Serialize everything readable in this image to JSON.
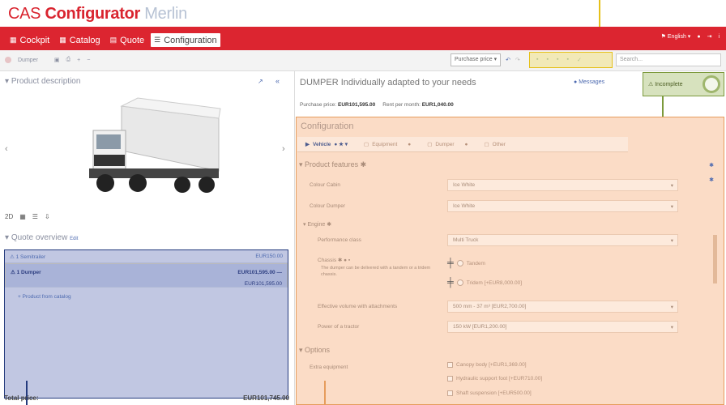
{
  "brand": {
    "cas": "CAS",
    "configurator": "Configurator",
    "merlin": "Merlin"
  },
  "nav": {
    "items": [
      {
        "label": "Cockpit"
      },
      {
        "label": "Catalog"
      },
      {
        "label": "Quote"
      },
      {
        "label": "Configuration"
      }
    ],
    "language": "English",
    "info": "i"
  },
  "toolbar": {
    "product": "Dumper",
    "price_select": "Purchase price",
    "search_placeholder": "Search..."
  },
  "left": {
    "product_description": "Product description",
    "quote_overview": "Quote overview",
    "edit": "Edit",
    "quote_rows": [
      {
        "name": "1 Semitrailer",
        "price": "EUR150.00",
        "price2": ""
      },
      {
        "name": "1 Dumper",
        "price": "EUR101,595.00",
        "price2": "EUR101,595.00"
      }
    ],
    "product_from_catalog": "+ Product from catalog",
    "total_label": "Total price:",
    "total_value": "EUR101,745.00",
    "view_2d": "2D"
  },
  "right": {
    "title": "DUMPER Individually adapted to your needs",
    "messages": "Messages",
    "incomplete": "Incomplete",
    "purchase_price_label": "Purchase price:",
    "purchase_price_value": "EUR101,595.00",
    "rent_label": "Rent per month:",
    "rent_value": "EUR1,040.00",
    "config": {
      "title": "Configuration",
      "tabs": [
        "Vehicle",
        "Equipment",
        "Dumper",
        "Other"
      ],
      "product_features": "Product features",
      "colour_cabin_label": "Colour Cabin",
      "colour_cabin_value": "Ice White",
      "colour_dumper_label": "Colour Dumper",
      "colour_dumper_value": "Ice White",
      "engine": "Engine",
      "performance_label": "Performance class",
      "performance_value": "Multi Truck",
      "chassis_label": "Chassis",
      "chassis_desc": "The dumper can be delivered with a tandem or a tridem chassis.",
      "tandem": "Tandem",
      "tridem": "Tridem [+EUR8,000.00]",
      "volume_label": "Effective volume with attachments",
      "volume_value": "500 mm - 37 m³ [EUR2,700.00]",
      "power_label": "Power of a tractor",
      "power_value": "150 kW [EUR1,200.00]",
      "options": "Options",
      "extra_label": "Extra equipment",
      "extras": [
        "Canopy body [+EUR1,369.00]",
        "Hydraulic support foot [+EUR710.00]",
        "Shaft suspension [+EUR500.00]"
      ]
    }
  },
  "colors": {
    "brand_red": "#dc2530",
    "quote_highlight": "#243a7d",
    "config_highlight": "#e69c5c",
    "status_highlight": "#7c9a3c",
    "toolbar_highlight": "#e6c01a"
  }
}
